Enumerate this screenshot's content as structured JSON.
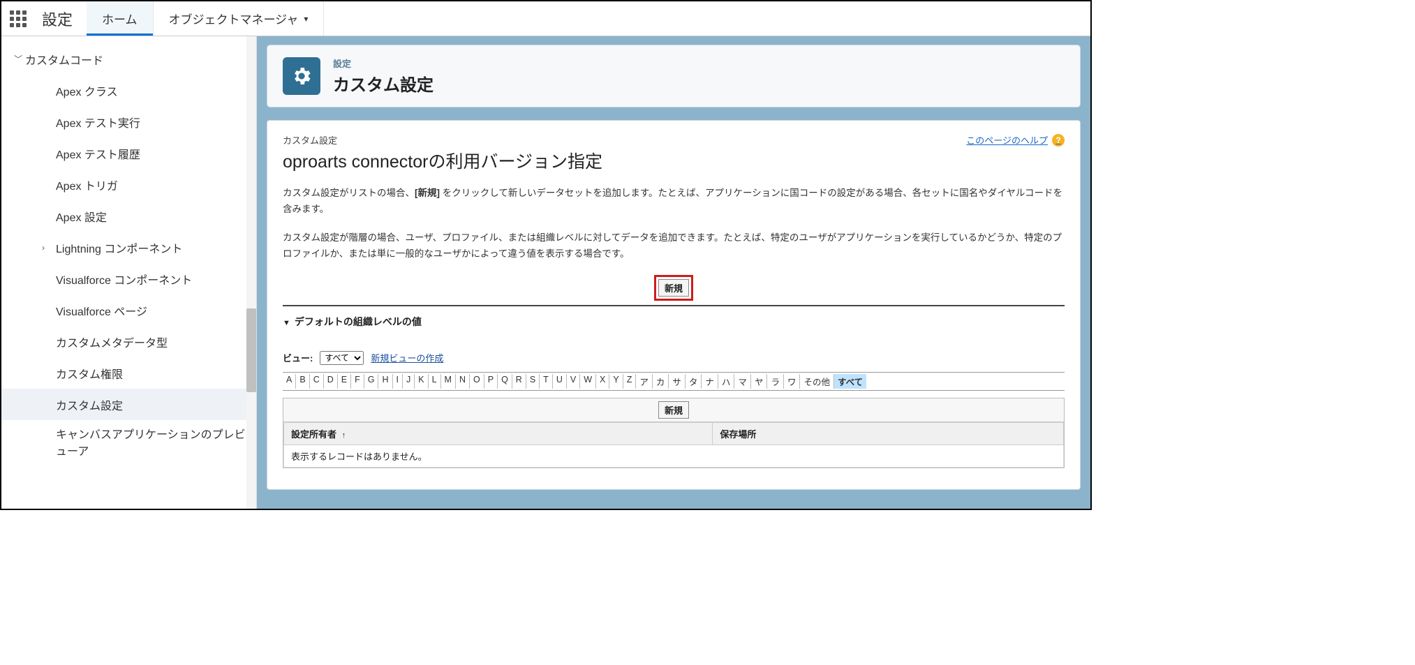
{
  "topbar": {
    "brand": "設定",
    "tabs": [
      {
        "label": "ホーム"
      },
      {
        "label": "オブジェクトマネージャ"
      }
    ]
  },
  "sidebar": {
    "parent": "カスタムコード",
    "items": [
      {
        "label": "Apex クラス"
      },
      {
        "label": "Apex テスト実行"
      },
      {
        "label": "Apex テスト履歴"
      },
      {
        "label": "Apex トリガ"
      },
      {
        "label": "Apex 設定"
      },
      {
        "label": "Lightning コンポーネント",
        "expandable": true
      },
      {
        "label": "Visualforce コンポーネント"
      },
      {
        "label": "Visualforce ページ"
      },
      {
        "label": "カスタムメタデータ型"
      },
      {
        "label": "カスタム権限"
      },
      {
        "label": "カスタム設定",
        "selected": true
      },
      {
        "label": "キャンバスアプリケーションのプレビューア"
      }
    ]
  },
  "hero": {
    "sub": "設定",
    "title": "カスタム設定"
  },
  "panel": {
    "breadcrumb": "カスタム設定",
    "title": "oproarts connectorの利用バージョン指定",
    "help": "このページのヘルプ",
    "desc1_a": "カスタム設定がリストの場合、",
    "desc1_b": "[新規]",
    "desc1_c": " をクリックして新しいデータセットを追加します。たとえば、アプリケーションに国コードの設定がある場合、各セットに国名やダイヤルコードを含みます。",
    "desc2": "カスタム設定が階層の場合、ユーザ、プロファイル、または組織レベルに対してデータを追加できます。たとえば、特定のユーザがアプリケーションを実行しているかどうか、特定のプロファイルか、または単に一般的なユーザかによって違う値を表示する場合です。",
    "new_btn": "新規",
    "section": "デフォルトの組織レベルの値",
    "view_label": "ビュー:",
    "view_value": "すべて",
    "new_view": "新規ビューの作成",
    "alpha": [
      "A",
      "B",
      "C",
      "D",
      "E",
      "F",
      "G",
      "H",
      "I",
      "J",
      "K",
      "L",
      "M",
      "N",
      "O",
      "P",
      "Q",
      "R",
      "S",
      "T",
      "U",
      "V",
      "W",
      "X",
      "Y",
      "Z",
      "ア",
      "カ",
      "サ",
      "タ",
      "ナ",
      "ハ",
      "マ",
      "ヤ",
      "ラ",
      "ワ",
      "その他",
      "すべて"
    ],
    "alpha_selected": "すべて",
    "table": {
      "new_btn": "新規",
      "col1": "設定所有者",
      "col2": "保存場所",
      "empty": "表示するレコードはありません。"
    }
  }
}
